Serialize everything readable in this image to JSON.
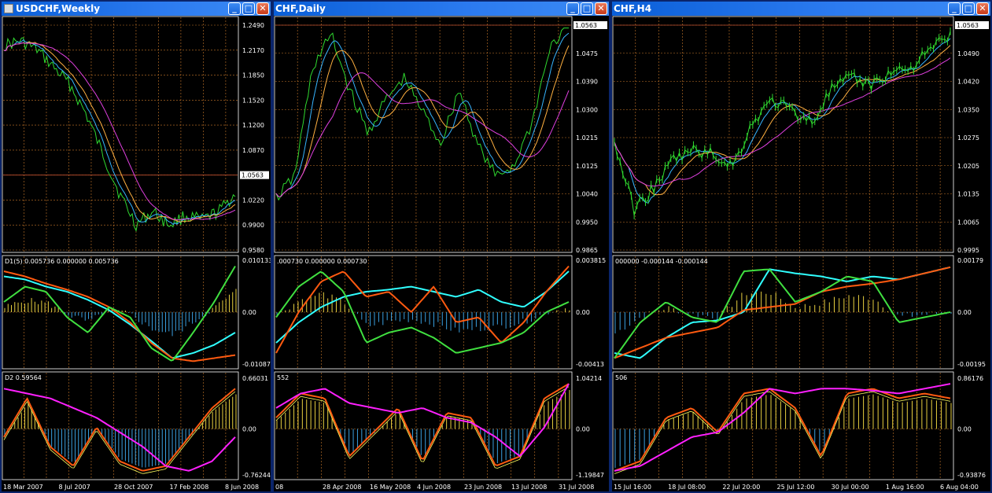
{
  "windows": [
    {
      "id": "weekly",
      "title": "USDCHF,Weekly",
      "price_axis": [
        "1.2490",
        "1.2170",
        "1.1850",
        "1.1520",
        "1.1200",
        "1.0870",
        "1.0563",
        "1.0220",
        "0.9900",
        "0.9580"
      ],
      "price_tag": "1.0563",
      "ind1_label": "D1(5) 0.005736 0.000000 0.005736",
      "ind1_axis": [
        "0.010133",
        "0.00",
        "-0.01087"
      ],
      "ind2_label": "D2 0.59564",
      "ind2_axis": [
        "0.66031",
        "0.00",
        "-0.76244"
      ],
      "time_axis": [
        "18 Mar 2007",
        "8 Jul 2007",
        "28 Oct 2007",
        "17 Feb 2008",
        "8 Jun 2008"
      ]
    },
    {
      "id": "daily",
      "title": "CHF,Daily",
      "price_axis": [
        "1.0563",
        "1.0475",
        "1.0390",
        "1.0300",
        "1.0215",
        "1.0125",
        "1.0040",
        "0.9950",
        "0.9865"
      ],
      "price_tag": "1.0563",
      "ind1_label": ".000730 0.000000 0.000730",
      "ind1_axis": [
        "0.003815",
        "0.00",
        "-0.00413"
      ],
      "ind2_label": "552",
      "ind2_axis": [
        "1.04214",
        "0.00",
        "-1.19847"
      ],
      "time_axis": [
        "08",
        "28 Apr 2008",
        "16 May 2008",
        "4 Jun 2008",
        "23 Jun 2008",
        "13 Jul 2008",
        "31 Jul 2008"
      ]
    },
    {
      "id": "h4",
      "title": "CHF,H4",
      "price_axis": [
        "1.0563",
        "1.0490",
        "1.0420",
        "1.0350",
        "1.0275",
        "1.0205",
        "1.0135",
        "1.0065",
        "0.9995"
      ],
      "price_tag": "1.0563",
      "ind1_label": "000000 -0.000144 -0.000144",
      "ind1_axis": [
        "0.00179",
        "0.00",
        "-0.00195"
      ],
      "ind2_label": "506",
      "ind2_axis": [
        "0.86176",
        "0.00",
        "-0.93876"
      ],
      "time_axis": [
        "15 Jul 16:00",
        "18 Jul 08:00",
        "22 Jul 20:00",
        "25 Jul 12:00",
        "30 Jul 00:00",
        "1 Aug 16:00",
        "6 Aug 04:00"
      ]
    }
  ],
  "colors": {
    "price": "#2fd82f",
    "ma_fast": "#36b4ff",
    "ma_mid": "#ffb040",
    "ma_slow": "#e040e0",
    "histo_pos": "#e8d040",
    "histo_neg": "#3aa0e0",
    "cyan": "#30ffff",
    "orange": "#ff5a10",
    "green": "#40e040",
    "magenta": "#ff20ff",
    "grid": "#c8782a"
  }
}
